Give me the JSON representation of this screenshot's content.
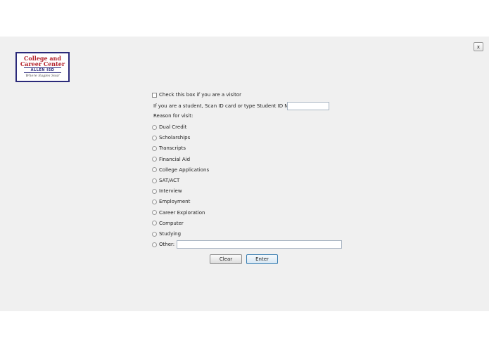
{
  "window": {
    "close_label": "x"
  },
  "logo": {
    "line1": "College and",
    "line2": "Career Center",
    "line3": "ALLEN ISD",
    "tagline": "Where Eagles Soar"
  },
  "form": {
    "visitor_checkbox_label": "Check this box if you are a visitor",
    "student_id_label": "If you are a student, Scan ID card or type Student ID Number:",
    "student_id_value": "",
    "reason_label": "Reason for visit:",
    "reasons": [
      "Dual Credit",
      "Scholarships",
      "Transcripts",
      "Financial Aid",
      "College Applications",
      "SAT/ACT",
      "Interview",
      "Employment",
      "Career Exploration",
      "Computer",
      "Studying"
    ],
    "other_label": "Other:",
    "other_value": ""
  },
  "buttons": {
    "clear": "Clear",
    "enter": "Enter"
  }
}
